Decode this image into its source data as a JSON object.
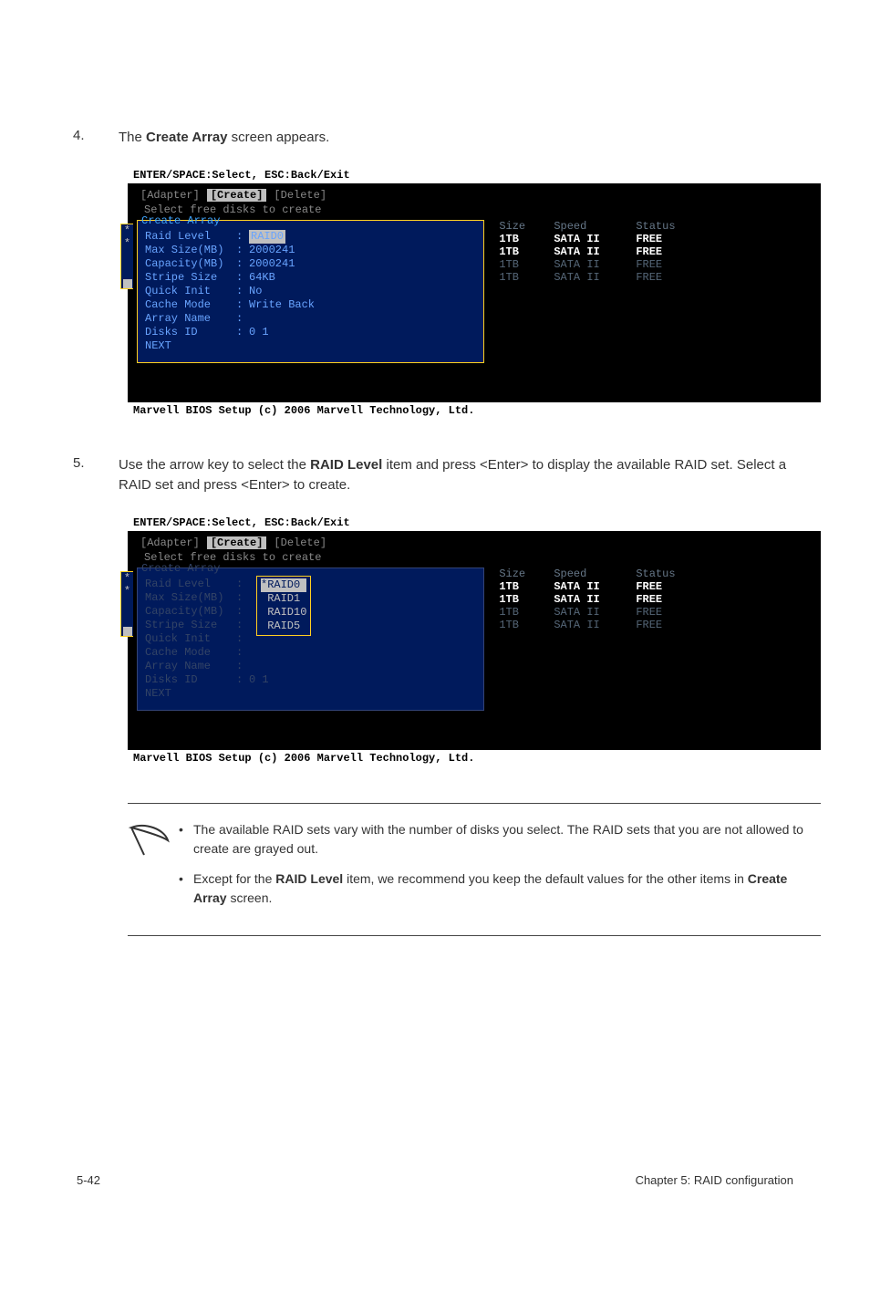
{
  "steps": {
    "s4_num": "4.",
    "s4_text_a": "The ",
    "s4_text_b": "Create Array",
    "s4_text_c": " screen appears.",
    "s5_num": "5.",
    "s5_text_a": "Use the arrow key to select the ",
    "s5_text_b": "RAID Level",
    "s5_text_c": " item and press <Enter> to display the available RAID set. Select a RAID set and press <Enter> to create."
  },
  "bios": {
    "top": "ENTER/SPACE:Select, ESC:Back/Exit",
    "tabs": {
      "t1": "[Adapter]",
      "t2": "[Create]",
      "t3": "[Delete]"
    },
    "subtitle": "Select free disks to create",
    "box_title": "Create Array",
    "footer": "Marvell BIOS Setup (c) 2006 Marvell Technology, Ltd."
  },
  "fields": {
    "raid_level_l": "Raid Level",
    "raid_level_v": "RAID0",
    "max_size_l": "Max Size(MB)",
    "max_size_v": "2000241",
    "capacity_l": "Capacity(MB)",
    "capacity_v": "2000241",
    "stripe_l": "Stripe Size",
    "stripe_v": "64KB",
    "quick_l": "Quick Init",
    "quick_v": "No",
    "cache_l": "Cache Mode",
    "cache_v": "Write Back",
    "array_l": "Array Name",
    "array_v": "",
    "disks_l": "Disks ID",
    "disks_v": "0 1",
    "next": "NEXT"
  },
  "chart_data": {
    "type": "table",
    "headers": [
      "Size",
      "Speed",
      "Status"
    ],
    "rows": [
      {
        "size": "1TB",
        "speed": "SATA II",
        "status": "FREE",
        "selected": true
      },
      {
        "size": "1TB",
        "speed": "SATA II",
        "status": "FREE",
        "selected": true
      },
      {
        "size": "1TB",
        "speed": "SATA II",
        "status": "FREE",
        "selected": false
      },
      {
        "size": "1TB",
        "speed": "SATA II",
        "status": "FREE",
        "selected": false
      }
    ]
  },
  "dropdown": {
    "o1": "*RAID0",
    "o2": " RAID1",
    "o3": " RAID10",
    "o4": " RAID5"
  },
  "note": {
    "n1_a": "The available RAID sets vary with the number of disks you select. The RAID sets that you are not allowed to create are grayed out.",
    "n2_a": "Except for the ",
    "n2_b": "RAID Level",
    "n2_c": " item, we recommend you keep the default values for the other items in ",
    "n2_d": "Create Array",
    "n2_e": " screen."
  },
  "footer": {
    "left": "5-42",
    "right": "Chapter 5: RAID configuration"
  }
}
